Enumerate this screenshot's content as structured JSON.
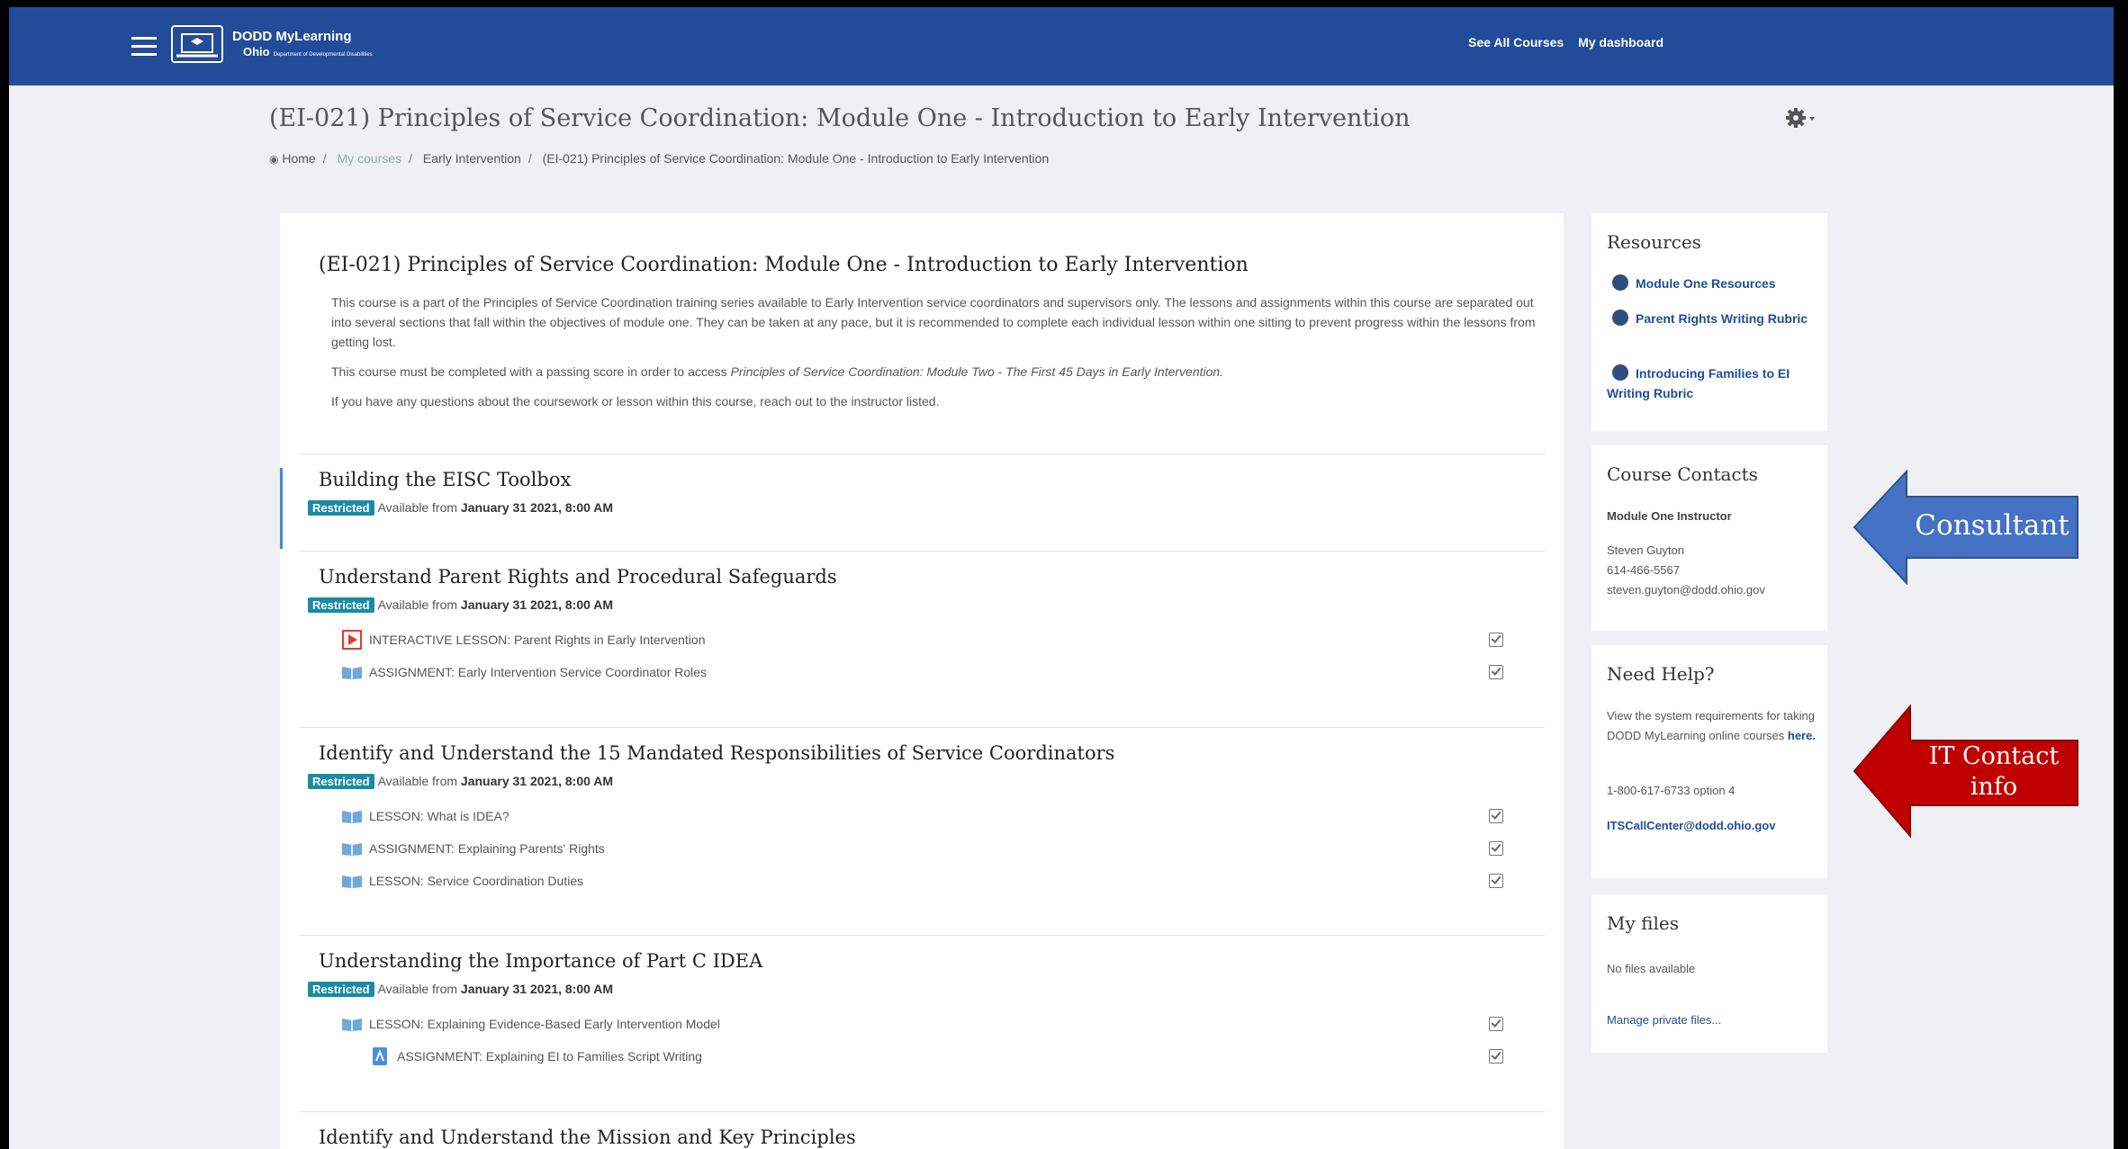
{
  "navbar": {
    "logo": {
      "line1": "DODD MyLearning",
      "line2": "Ohio",
      "line3": "Department of Developmental Disabilities"
    },
    "links": [
      "See All Courses",
      "My dashboard"
    ]
  },
  "page": {
    "title": "(EI-021) Principles of Service Coordination: Module One - Introduction to Early Intervention",
    "breadcrumb": {
      "home": "Home",
      "my_courses": "My courses",
      "category": "Early Intervention",
      "current": "(EI-021) Principles of Service Coordination: Module One - Introduction to Early Intervention"
    }
  },
  "course": {
    "title": "(EI-021) Principles of Service Coordination: Module One - Introduction to Early Intervention",
    "summary_p1": "This course is a part of the Principles of Service Coordination training series available to Early Intervention service coordinators and supervisors only. The lessons and assignments within this course are separated out into several sections that fall within the objectives of module one. They can be taken at any pace, but it is recommended to complete each individual lesson within one sitting to prevent progress within the lessons from getting lost.",
    "summary_p2_prefix": "This course must be completed with a passing score in order to access ",
    "summary_p2_italic": "Principles of Service Coordination: Module Two - The First 45 Days in Early Intervention.",
    "summary_p3": "If you have any questions about the coursework or lesson within this course, reach out to the instructor listed.",
    "restriction": {
      "badge": "Restricted",
      "prefix": "Available from",
      "date": "January 31 2021, 8:00 AM"
    },
    "sections": [
      {
        "title": "Building the EISC Toolbox",
        "activities": []
      },
      {
        "title": "Understand Parent Rights and Procedural Safeguards",
        "activities": [
          {
            "icon": "play-icon",
            "label": "INTERACTIVE LESSON: Parent Rights in Early Intervention"
          },
          {
            "icon": "book-icon",
            "label": "ASSIGNMENT: Early Intervention Service Coordinator Roles"
          }
        ]
      },
      {
        "title": "Identify and Understand the 15 Mandated Responsibilities of Service Coordinators",
        "activities": [
          {
            "icon": "book-icon",
            "label": "LESSON: What is IDEA?"
          },
          {
            "icon": "book-icon",
            "label": "ASSIGNMENT: Explaining Parents' Rights"
          },
          {
            "icon": "book-icon",
            "label": "LESSON: Service Coordination Duties"
          }
        ]
      },
      {
        "title": "Understanding the Importance of Part C IDEA",
        "activities": [
          {
            "icon": "book-icon",
            "label": "LESSON: Explaining Evidence-Based Early Intervention Model"
          },
          {
            "icon": "assignment-icon",
            "label": "ASSIGNMENT: Explaining EI to Families Script Writing"
          }
        ]
      },
      {
        "title": "Identify and Understand the Mission and Key Principles",
        "activities": []
      }
    ]
  },
  "sidebar": {
    "resources": {
      "title": "Resources",
      "items": [
        "Module One Resources",
        "Parent Rights Writing Rubric",
        "Introducing Families to EI Writing Rubric"
      ]
    },
    "contacts": {
      "title": "Course Contacts",
      "role": "Module One Instructor",
      "name": "Steven Guyton",
      "phone": "614-466-5567",
      "email": "steven.guyton@dodd.ohio.gov"
    },
    "help": {
      "title": "Need Help?",
      "text": "View the system requirements for taking DODD MyLearning online courses",
      "link": "here.",
      "phone": "1-800-617-6733 option 4",
      "email": "ITSCallCenter@dodd.ohio.gov"
    },
    "files": {
      "title": "My files",
      "empty": "No files available",
      "manage": "Manage private files..."
    }
  },
  "callouts": {
    "consultant": {
      "text": "Consultant",
      "color": "#4472c4"
    },
    "it_contact": {
      "line1": "IT Contact",
      "line2": "info",
      "color": "#c00000"
    }
  }
}
